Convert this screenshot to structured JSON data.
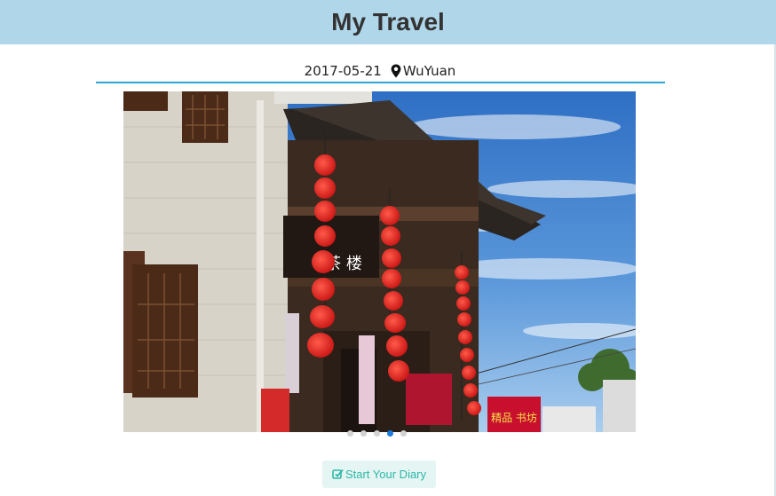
{
  "header": {
    "title": "My Travel"
  },
  "post": {
    "date": "2017-05-21",
    "location": "WuYuan",
    "location_icon": "map-marker-icon"
  },
  "carousel": {
    "slide_count": 5,
    "active_index": 3,
    "sign_texts": [
      "茶 楼",
      "精品 书坊"
    ]
  },
  "diary_button": {
    "label": "Start Your Diary",
    "icon": "edit-icon"
  },
  "colors": {
    "header_bg": "#b0d6ea",
    "divider": "#27a7d2",
    "active_dot": "#1c7be0",
    "button_text": "#2db8a8",
    "button_bg": "#e5f5f3"
  }
}
